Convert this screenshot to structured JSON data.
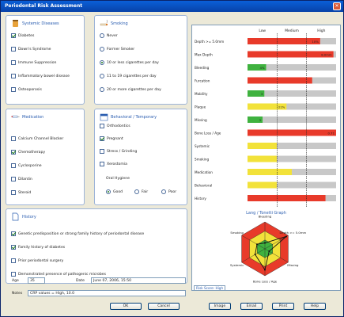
{
  "window": {
    "title": "Periodontal Risk Assessment"
  },
  "systemic": {
    "title": "Systemic Diseases",
    "items": [
      {
        "label": "Diabetes",
        "checked": true
      },
      {
        "label": "Down's Syndrome",
        "checked": false
      },
      {
        "label": "Immune Suppression",
        "checked": false
      },
      {
        "label": "Inflammatory bowel disease",
        "checked": false
      },
      {
        "label": "Osteoporosis",
        "checked": false
      }
    ]
  },
  "smoking": {
    "title": "Smoking",
    "items": [
      {
        "label": "Never",
        "selected": false
      },
      {
        "label": "Former Smoker",
        "selected": false
      },
      {
        "label": "10 or less cigarettes per day",
        "selected": true
      },
      {
        "label": "11 to 19 cigarettes per day",
        "selected": false
      },
      {
        "label": "20 or more cigarettes per day",
        "selected": false
      }
    ]
  },
  "medication": {
    "title": "Medication",
    "items": [
      {
        "label": "Calcium Channel Blocker",
        "checked": false
      },
      {
        "label": "Chemotherapy",
        "checked": true
      },
      {
        "label": "Cyclosporine",
        "checked": false
      },
      {
        "label": "Dilantin",
        "checked": false
      },
      {
        "label": "Steroid",
        "checked": false
      }
    ]
  },
  "behavioral": {
    "title": "Behavioral / Temporary",
    "items": [
      {
        "label": "Orthodontics",
        "checked": false
      },
      {
        "label": "Pregnant",
        "checked": true
      },
      {
        "label": "Stress / Grinding",
        "checked": false
      },
      {
        "label": "Xerostomia",
        "checked": false
      }
    ],
    "oral_hygiene_label": "Oral Hygiene",
    "hygiene_options": [
      {
        "label": "Good",
        "selected": true
      },
      {
        "label": "Fair",
        "selected": false
      },
      {
        "label": "Poor",
        "selected": false
      }
    ]
  },
  "history": {
    "title": "History",
    "items": [
      {
        "label": "Genetic predisposition or strong family history of periodontal disease",
        "checked": true
      },
      {
        "label": "Family history of diabetes",
        "checked": true
      },
      {
        "label": "Prior periodontal surgery",
        "checked": false
      },
      {
        "label": "Demonstrated presence of pathogenic microbes",
        "checked": false
      }
    ]
  },
  "form": {
    "age_label": "Age",
    "age_value": "35",
    "date_label": "Date",
    "date_value": "June 07, 2006, 15:50",
    "notes_label": "Notes",
    "notes_value": "CRP values = High, 10.0"
  },
  "buttons": {
    "ok": "OK",
    "cancel": "Cancel",
    "image": "Image",
    "email": "Email",
    "print": "Print",
    "help": "Help"
  },
  "colors": {
    "high": "#e83a2a",
    "medium": "#f2e23a",
    "low": "#3fb23f",
    "empty": "#c8c8c8"
  },
  "chart_data": [
    {
      "type": "bar",
      "orientation": "horizontal",
      "column_headers": [
        "Low",
        "Medium",
        "High"
      ],
      "categories": [
        "Depth >= 5.0mm",
        "Max Depth",
        "Bleeding",
        "Furcation",
        "Mobility",
        "Plaque",
        "Missing",
        "Bone Loss / Age",
        "Systemic",
        "Smoking",
        "Medication",
        "Behavioral",
        "History"
      ],
      "values": [
        0.82,
        0.97,
        0.21,
        0.73,
        0.19,
        0.44,
        0.17,
        1.0,
        0.33,
        0.33,
        0.5,
        0.33,
        0.88
      ],
      "value_labels": [
        "10%",
        "8.0mm",
        "4%",
        "",
        "3",
        "21%",
        "3",
        "0.71",
        "",
        "",
        "",
        "",
        ""
      ],
      "risk_level": [
        "high",
        "high",
        "low",
        "high",
        "low",
        "medium",
        "low",
        "high",
        "medium",
        "medium",
        "medium",
        "medium",
        "high"
      ]
    },
    {
      "type": "radar",
      "title": "Lang / Tonetti Graph",
      "axes": [
        "Bleeding",
        "Depth >= 5.0mm",
        "Missing",
        "Bone Loss / Age",
        "Systemic",
        "Smoking"
      ],
      "values": [
        0.22,
        0.92,
        0.18,
        0.78,
        0.42,
        0.34
      ],
      "risk_score_label": "Risk Score: High"
    }
  ]
}
